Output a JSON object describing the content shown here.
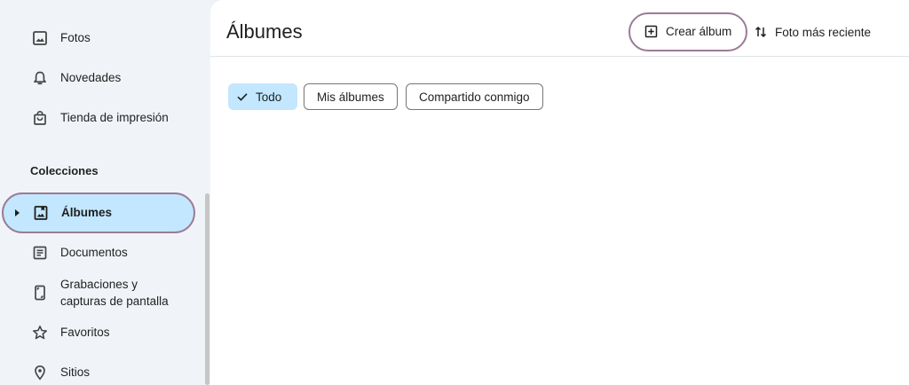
{
  "sidebar": {
    "items_top": [
      {
        "label": "Fotos",
        "icon": "photo-icon"
      },
      {
        "label": "Novedades",
        "icon": "bell-icon"
      },
      {
        "label": "Tienda de impresión",
        "icon": "shopping-bag-icon"
      }
    ],
    "section_title": "Colecciones",
    "collections": [
      {
        "label": "Álbumes",
        "icon": "album-icon",
        "active": true
      },
      {
        "label": "Documentos",
        "icon": "document-icon"
      },
      {
        "label_line1": "Grabaciones y",
        "label_line2": "capturas de pantalla",
        "icon": "phone-screenshot-icon"
      },
      {
        "label": "Favoritos",
        "icon": "star-icon"
      },
      {
        "label": "Sitios",
        "icon": "location-pin-icon"
      }
    ]
  },
  "main": {
    "title": "Álbumes",
    "create_label": "Crear álbum",
    "sort_label": "Foto más reciente",
    "chips": [
      {
        "label": "Todo",
        "selected": true
      },
      {
        "label": "Mis álbumes"
      },
      {
        "label": "Compartido conmigo"
      }
    ]
  },
  "colors": {
    "accent_bg": "#c2e7ff",
    "highlight_outline": "#9c7a96",
    "sidebar_bg": "#f0f4f9"
  }
}
